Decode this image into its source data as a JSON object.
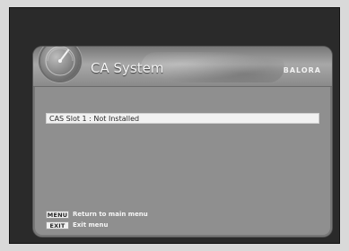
{
  "header": {
    "title": "CA System",
    "brand": "BALORA"
  },
  "content": {
    "items": [
      {
        "label": "CAS Slot 1 : Not Installed"
      }
    ]
  },
  "footer": {
    "hints": [
      {
        "key": "MENU",
        "text": "Return to main menu"
      },
      {
        "key": "EXIT",
        "text": "Exit menu"
      }
    ]
  }
}
